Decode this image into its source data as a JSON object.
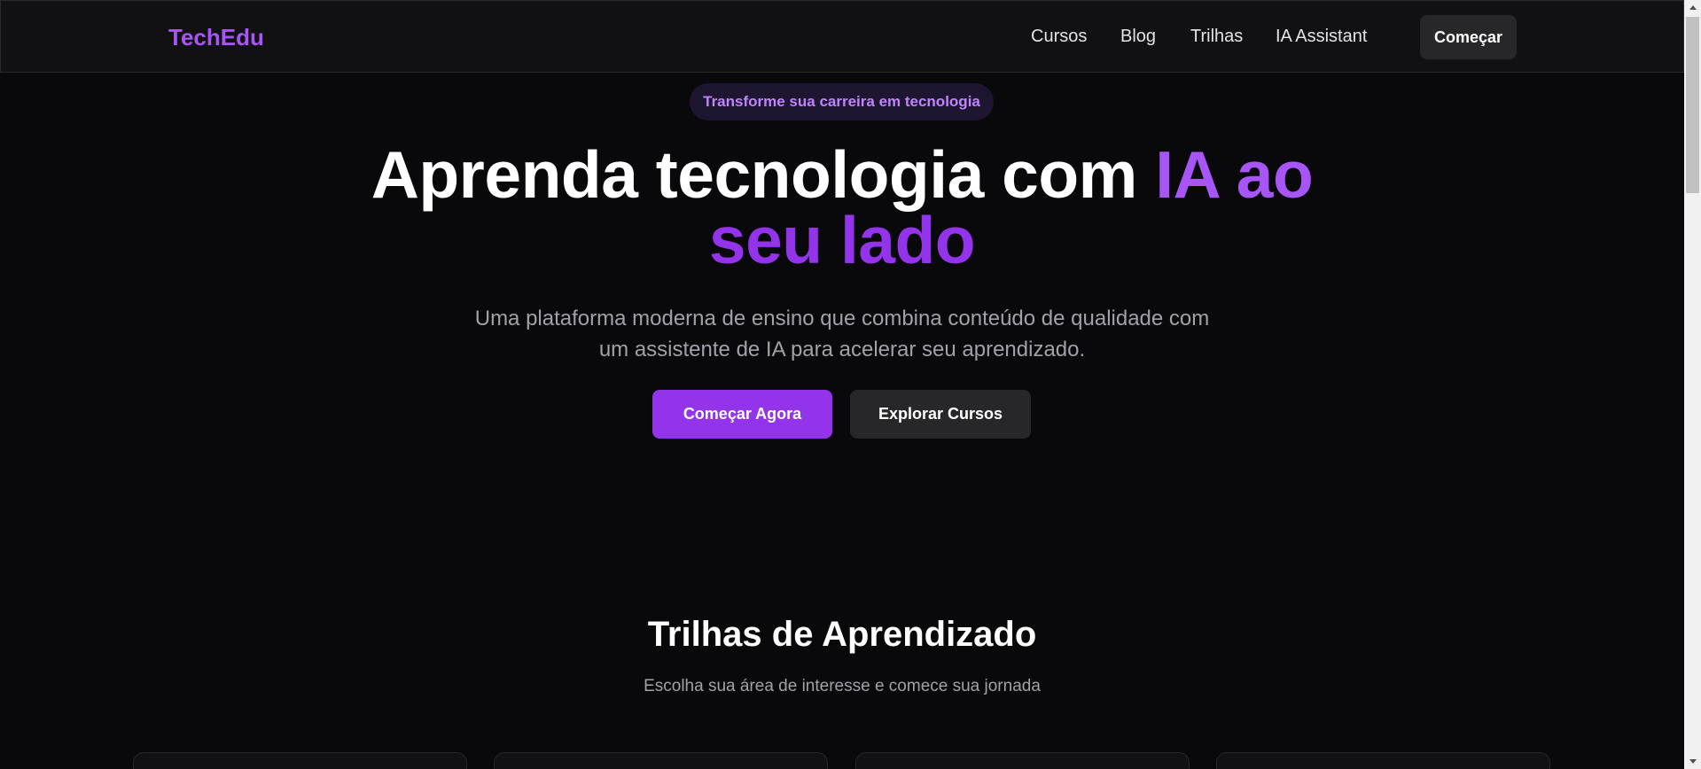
{
  "header": {
    "logo": "TechEdu",
    "nav": [
      "Cursos",
      "Blog",
      "Trilhas",
      "IA Assistant"
    ],
    "cta_label": "Começar"
  },
  "hero": {
    "badge": "Transforme sua carreira em tecnologia",
    "title_plain": "Aprenda tecnologia com ",
    "title_accent_1": "IA ao",
    "title_accent_2": "seu lado",
    "subtitle": "Uma plataforma moderna de ensino que combina conteúdo de qualidade com um assistente de IA para acelerar seu aprendizado.",
    "primary_button": "Começar Agora",
    "secondary_button": "Explorar Cursos"
  },
  "trails_section": {
    "title": "Trilhas de Aprendizado",
    "subtitle": "Escolha sua área de interesse e comece sua jornada"
  },
  "colors": {
    "background": "#09090b",
    "accent": "#9333ea",
    "accent_light": "#a855f7",
    "muted_text": "#a1a1aa"
  }
}
